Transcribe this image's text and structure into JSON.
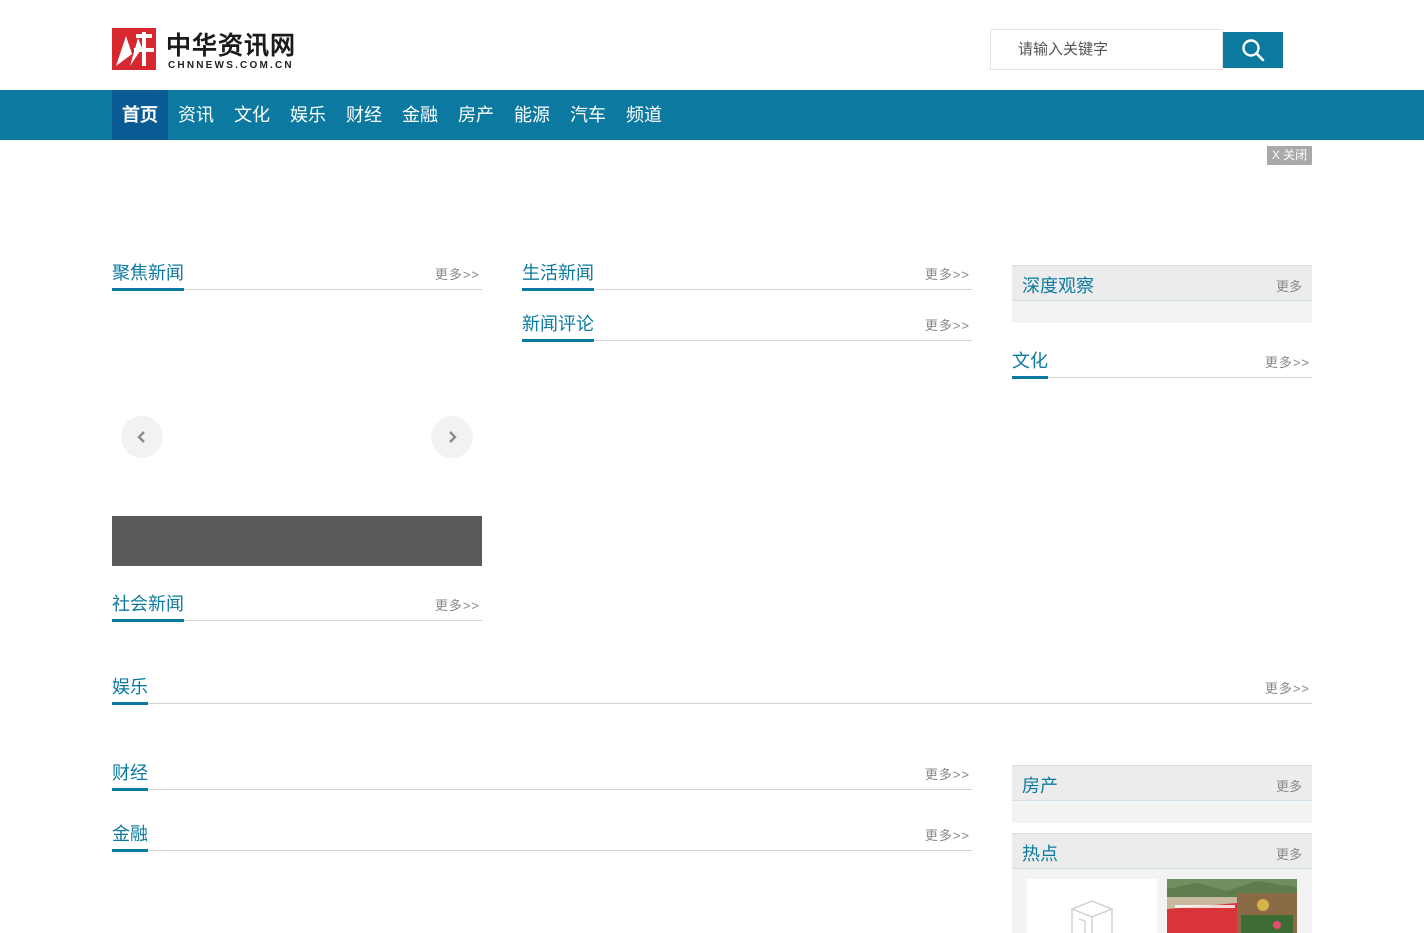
{
  "header": {
    "logo_cn": "中华资讯网",
    "logo_en": "CHNNEWS.COM.CN",
    "search_placeholder": "请输入关键字"
  },
  "nav": {
    "items": [
      "首页",
      "资讯",
      "文化",
      "娱乐",
      "财经",
      "金融",
      "房产",
      "能源",
      "汽车",
      "频道"
    ],
    "active_index": 0
  },
  "ad": {
    "close_label": "X 关闭"
  },
  "sections": {
    "focus": {
      "title": "聚焦新闻",
      "more": "更多>>"
    },
    "life": {
      "title": "生活新闻",
      "more": "更多>>"
    },
    "comment": {
      "title": "新闻评论",
      "more": "更多>>"
    },
    "deep": {
      "title": "深度观察",
      "more": "更多"
    },
    "culture": {
      "title": "文化",
      "more": "更多>>"
    },
    "society": {
      "title": "社会新闻",
      "more": "更多>>"
    },
    "ent": {
      "title": "娱乐",
      "more": "更多>>"
    },
    "finance": {
      "title": "财经",
      "more": "更多>>"
    },
    "banking": {
      "title": "金融",
      "more": "更多>>"
    },
    "house": {
      "title": "房产",
      "more": "更多"
    },
    "hot": {
      "title": "热点",
      "more": "更多"
    }
  },
  "colors": {
    "brand": "#0c7aa0",
    "nav_active": "#0a5a94",
    "logo_red": "#d7282f"
  },
  "icons": [
    "search-icon",
    "chevron-left-icon",
    "chevron-right-icon"
  ]
}
